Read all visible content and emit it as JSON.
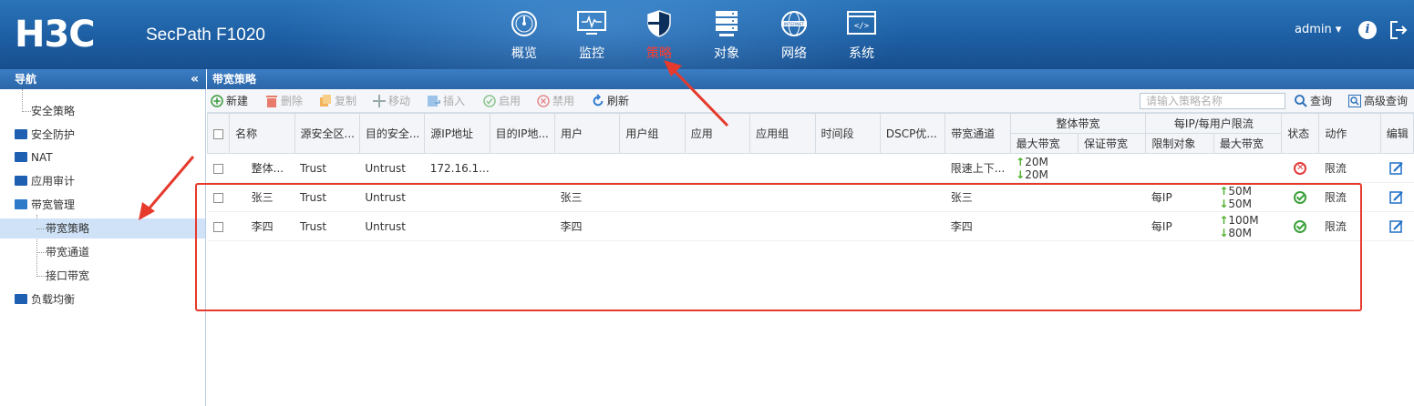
{
  "header": {
    "logo": "H3C",
    "product": "SecPath F1020",
    "nav": [
      {
        "label": "概览",
        "icon": "gauge-icon"
      },
      {
        "label": "监控",
        "icon": "monitor-icon"
      },
      {
        "label": "策略",
        "icon": "shield-icon"
      },
      {
        "label": "对象",
        "icon": "server-icon"
      },
      {
        "label": "网络",
        "icon": "internet-icon"
      },
      {
        "label": "系统",
        "icon": "code-window-icon"
      }
    ],
    "active_nav": "策略",
    "user": "admin ▾",
    "info": "i"
  },
  "sidebar": {
    "title": "导航",
    "collapse": "«",
    "items": [
      {
        "label": "安全策略"
      },
      {
        "label": "安全防护"
      },
      {
        "label": "NAT"
      },
      {
        "label": "应用审计"
      },
      {
        "label": "带宽管理"
      },
      {
        "label": "带宽策略"
      },
      {
        "label": "带宽通道"
      },
      {
        "label": "接口带宽"
      },
      {
        "label": "负载均衡"
      }
    ],
    "selected": "带宽策略"
  },
  "main": {
    "title": "带宽策略",
    "toolbar": {
      "new": "新建",
      "delete": "删除",
      "copy": "复制",
      "move": "移动",
      "insert": "插入",
      "enable": "启用",
      "disable": "禁用",
      "refresh": "刷新",
      "search_placeholder": "请输入策略名称",
      "search": "查询",
      "advanced_search": "高级查询"
    },
    "columns": {
      "name": "名称",
      "src_zone": "源安全区...",
      "dst_zone": "目的安全...",
      "src_ip": "源IP地址",
      "dst_ip": "目的IP地...",
      "user": "用户",
      "user_group": "用户组",
      "app": "应用",
      "app_group": "应用组",
      "time_range": "时间段",
      "dscp": "DSCP优...",
      "channel": "带宽通道",
      "overall_bw": "整体带宽",
      "max_bw": "最大带宽",
      "guaranteed_bw": "保证带宽",
      "per_limit": "每IP/每用户限流",
      "limit_target": "限制对象",
      "per_max_bw": "最大带宽",
      "status": "状态",
      "action": "动作",
      "edit": "编辑"
    },
    "rows": [
      {
        "name": "整体...",
        "src_zone": "Trust",
        "dst_zone": "Untrust",
        "src_ip": "172.16.1...",
        "dst_ip": "",
        "user": "",
        "user_group": "",
        "app": "",
        "app_group": "",
        "time_range": "",
        "dscp": "",
        "channel": "限速上下...",
        "max_up": "20M",
        "max_down": "20M",
        "guaranteed": "",
        "limit_target": "",
        "per_up": "",
        "per_down": "",
        "status": "disabled",
        "action": "限流"
      },
      {
        "name": "张三",
        "src_zone": "Trust",
        "dst_zone": "Untrust",
        "src_ip": "",
        "dst_ip": "",
        "user": "张三",
        "user_group": "",
        "app": "",
        "app_group": "",
        "time_range": "",
        "dscp": "",
        "channel": "张三",
        "max_up": "",
        "max_down": "",
        "guaranteed": "",
        "limit_target": "每IP",
        "per_up": "50M",
        "per_down": "50M",
        "status": "enabled",
        "action": "限流"
      },
      {
        "name": "李四",
        "src_zone": "Trust",
        "dst_zone": "Untrust",
        "src_ip": "",
        "dst_ip": "",
        "user": "李四",
        "user_group": "",
        "app": "",
        "app_group": "",
        "time_range": "",
        "dscp": "",
        "channel": "李四",
        "max_up": "",
        "max_down": "",
        "guaranteed": "",
        "limit_target": "每IP",
        "per_up": "100M",
        "per_down": "80M",
        "status": "enabled",
        "action": "限流"
      }
    ]
  },
  "colors": {
    "header_blue": "#1d5ea3",
    "active_nav": "#ff3b2f",
    "annotation_red": "#e53a2c",
    "ok_green": "#3aa13a",
    "off_red": "#e23a3a"
  }
}
